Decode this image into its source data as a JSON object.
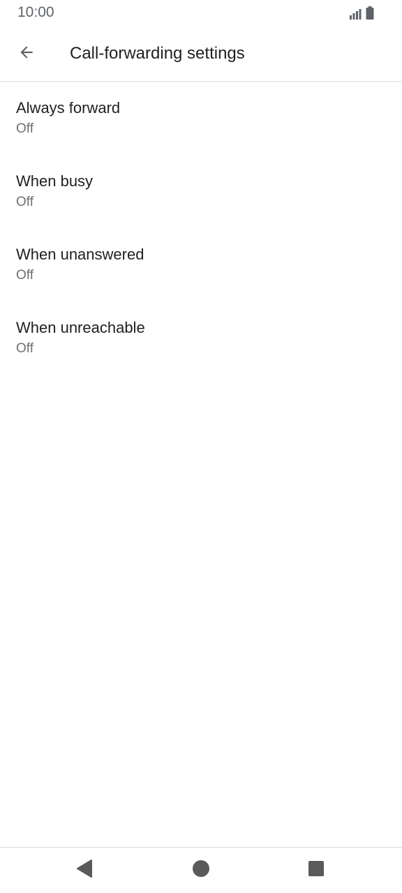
{
  "status_bar": {
    "time": "10:00",
    "icons": [
      "signal-icon",
      "battery-icon"
    ]
  },
  "app_bar": {
    "back_icon": "arrow-back-icon",
    "title": "Call-forwarding settings"
  },
  "list": {
    "items": [
      {
        "title": "Always forward",
        "summary": "Off"
      },
      {
        "title": "When busy",
        "summary": "Off"
      },
      {
        "title": "When unanswered",
        "summary": "Off"
      },
      {
        "title": "When unreachable",
        "summary": "Off"
      }
    ]
  },
  "nav_bar": {
    "icons": [
      "nav-back-icon",
      "nav-home-icon",
      "nav-recents-icon"
    ]
  },
  "colors": {
    "icon_gray": "#5f6368",
    "nav_icon": "#5a5a5a",
    "text_primary": "#202124",
    "text_secondary": "#6f6f6f"
  }
}
